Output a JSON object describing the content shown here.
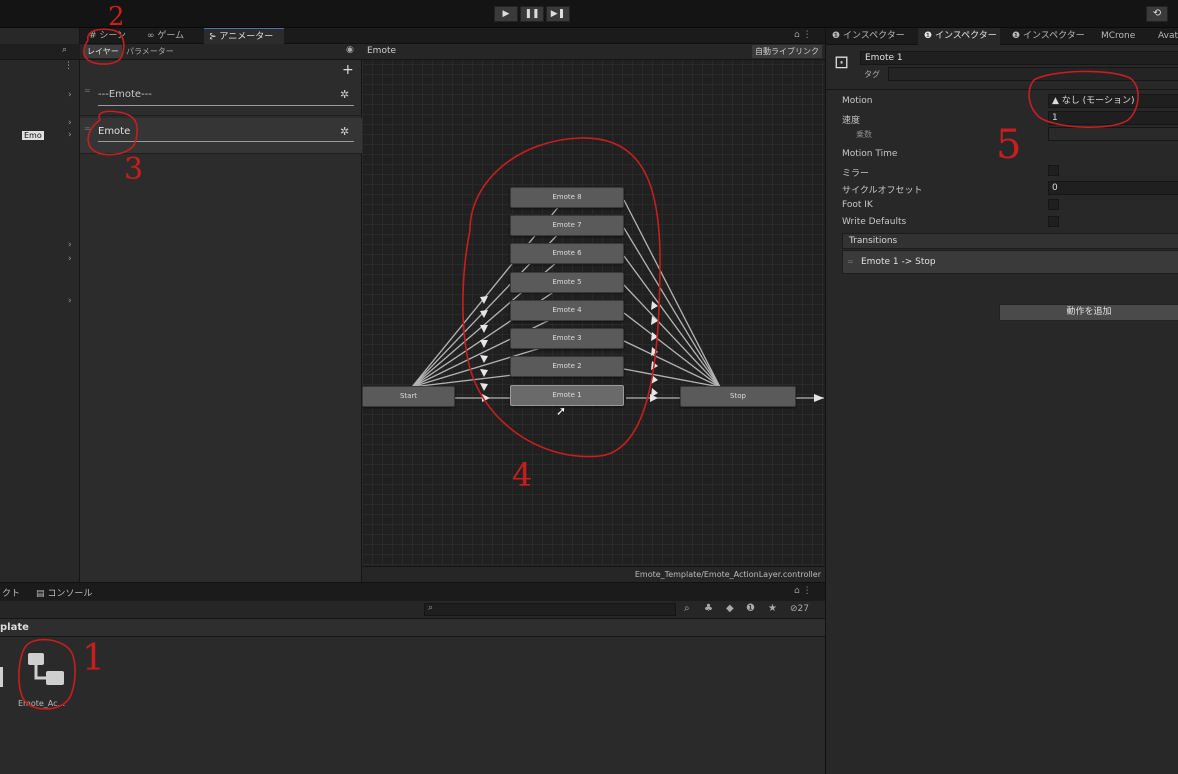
{
  "toolbar": {
    "play": "▶",
    "pause": "❚❚",
    "step": "▶❚",
    "history": "⟲"
  },
  "left_tabs": {
    "scene": "シーン",
    "game": "ゲーム",
    "animator": "アニメーター"
  },
  "layers_panel": {
    "tab_layers": "レイヤー",
    "tab_parameters": "パラメーター",
    "layers": [
      {
        "name": "---Emote---"
      },
      {
        "name": "Emote"
      }
    ],
    "hierarchy_item": "Emo"
  },
  "graph": {
    "breadcrumb": "Emote",
    "auto_live_link": "自動ライブリンク",
    "footer_path": "Emote_Template/Emote_ActionLayer.controller",
    "nodes": {
      "start": "Start",
      "stop": "Stop",
      "emote8": "Emote 8",
      "emote7": "Emote 7",
      "emote6": "Emote 6",
      "emote5": "Emote 5",
      "emote4": "Emote 4",
      "emote3": "Emote 3",
      "emote2": "Emote 2",
      "emote1": "Emote 1"
    }
  },
  "inspector": {
    "tabs": [
      "インスペクター",
      "インスペクター",
      "インスペクター",
      "MCrone",
      "Avat"
    ],
    "object_name": "Emote 1",
    "tag_label": "タグ",
    "props": {
      "motion_label": "Motion",
      "motion_value": "なし (モーション)",
      "speed_label": "速度",
      "speed_value": "1",
      "multiplier_label": "乗数",
      "motion_time_label": "Motion Time",
      "mirror_label": "ミラー",
      "cycle_offset_label": "サイクルオフセット",
      "cycle_offset_value": "0",
      "foot_ik_label": "Foot IK",
      "write_defaults_label": "Write Defaults"
    },
    "transitions_label": "Transitions",
    "transition_item": "Emote 1 -> Stop",
    "add_behaviour": "動作を追加"
  },
  "bottom": {
    "tab_project": "クト",
    "tab_console": "コンソール",
    "folder_title": "plate",
    "asset_name": "Emote_Ac...",
    "hidden_count": "27"
  },
  "annotations": [
    "1",
    "2",
    "3",
    "4",
    "5"
  ],
  "colors": {
    "annotation_red": "#c81e1e",
    "accent_blue": "#4a6ea9"
  }
}
